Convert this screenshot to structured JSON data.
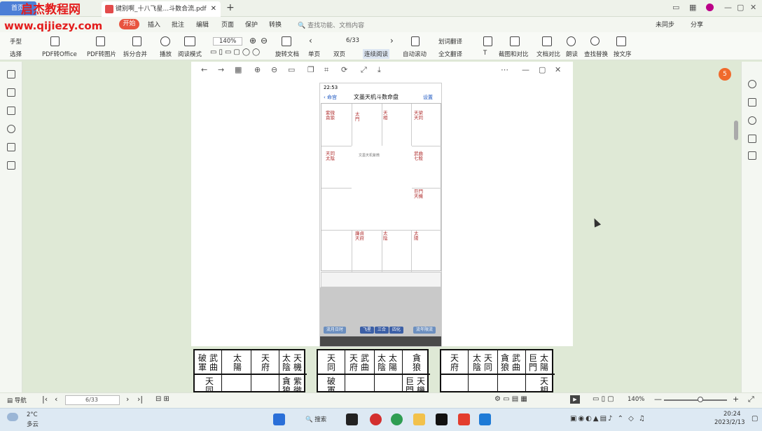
{
  "watermark": {
    "line1": "启杰教程网",
    "line2": "www.qijiezy.com"
  },
  "tabs": {
    "home": "首页",
    "doc": "键别啊_十八飞星...斗数合流.pdf",
    "add": "+"
  },
  "menu": [
    "开始",
    "插入",
    "批注",
    "编辑",
    "页面",
    "保护",
    "转换"
  ],
  "search_placeholder": "查找功能、文档内容",
  "account": {
    "sync": "未同步",
    "share": "分享"
  },
  "toolbar": {
    "hand": "手型",
    "select": "选择",
    "pdf_office": "PDF转Office",
    "pdf_image": "PDF转图片",
    "split": "拆分合并",
    "play": "播放",
    "read_mode": "阅读模式",
    "zoom": "140%",
    "page": "6/33",
    "rotate": "旋转文档",
    "single": "单页",
    "double": "双页",
    "continuous": "连续阅读",
    "auto_scroll": "自动滚动",
    "translate_word": "划词翻译",
    "translate_full": "全文翻译",
    "ocr": "截图和对比",
    "compare": "文档对比",
    "read_aloud": "朗读",
    "find": "查找替换",
    "text_order": "按文序"
  },
  "phone": {
    "time": "22:53",
    "title": "文墨天机斗数命盘",
    "back": "命宫",
    "settings": "设置",
    "center_title": "文墨天机紫微",
    "buttons": [
      "飞星",
      "三合",
      "四化"
    ],
    "left_btn": "流月日时",
    "right_btn": "流年限流"
  },
  "tables": [
    {
      "top": [
        "破軍",
        "武曲",
        "太陽",
        "天府",
        "太陰",
        "天機"
      ],
      "bottom": [
        "天同",
        "",
        "",
        "",
        "貪狼",
        "紫微"
      ]
    },
    {
      "top": [
        "天同",
        "天府",
        "武曲",
        "太陰",
        "太陽",
        "貪狼"
      ],
      "bottom": [
        "破軍",
        "",
        "",
        "",
        "巨門",
        "天機"
      ]
    },
    {
      "top": [
        "天府",
        "太陰",
        "天同",
        "貪狼",
        "武曲",
        "巨門",
        "太陽"
      ],
      "bottom": [
        "",
        "",
        "",
        "",
        "",
        "天相"
      ]
    }
  ],
  "status": {
    "nav": "导航",
    "page_input": "6/33",
    "zoom": "140%"
  },
  "taskbar": {
    "weather_temp": "2°C",
    "weather_desc": "多云",
    "search": "搜索",
    "time": "20:24",
    "date": "2023/2/13"
  },
  "badge": "5"
}
